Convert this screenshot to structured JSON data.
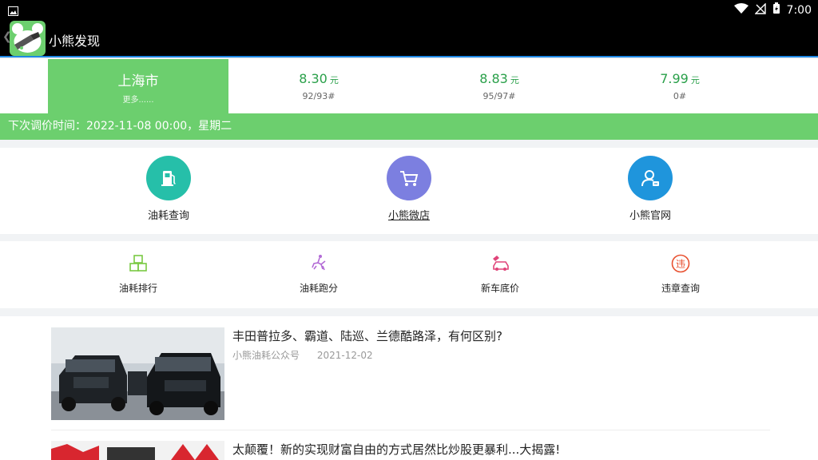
{
  "status_bar": {
    "time": "7:00"
  },
  "app_bar": {
    "title": "小熊发现",
    "back_glyph": "❮"
  },
  "city": {
    "name": "上海市",
    "more": "更多......"
  },
  "prices": [
    {
      "value": "8.30",
      "unit": "元",
      "grade": "92/93#"
    },
    {
      "value": "8.83",
      "unit": "元",
      "grade": "95/97#"
    },
    {
      "value": "7.99",
      "unit": "元",
      "grade": "0#"
    }
  ],
  "adjust_notice": "下次调价时间：2022-11-08 00:00，星期二",
  "main_icons": [
    {
      "label": "油耗查询",
      "icon": "fuel-pump-icon",
      "color": "#26bfa9"
    },
    {
      "label": "小熊微店",
      "icon": "shopping-cart-icon",
      "color": "#7c7fe0"
    },
    {
      "label": "小熊官网",
      "icon": "user-card-icon",
      "color": "#1f95dc"
    }
  ],
  "sub_icons": [
    {
      "label": "油耗排行",
      "icon": "boxes-icon",
      "color": "#7ac943"
    },
    {
      "label": "油耗跑分",
      "icon": "horse-rider-icon",
      "color": "#b36bd6"
    },
    {
      "label": "新车底价",
      "icon": "car-tag-icon",
      "color": "#e0457a"
    },
    {
      "label": "违章查询",
      "icon": "violation-icon",
      "color": "#e8502f"
    }
  ],
  "articles": [
    {
      "title": "丰田普拉多、霸道、陆巡、兰德酷路泽，有何区别?",
      "source": "小熊油耗公众号",
      "date": "2021-12-02"
    },
    {
      "title": "太颠覆！新的实现财富自由的方式居然比炒股更暴利...大揭露!"
    }
  ],
  "colors": {
    "brand_green": "#6ccf6e",
    "price_green": "#2aa04a"
  }
}
